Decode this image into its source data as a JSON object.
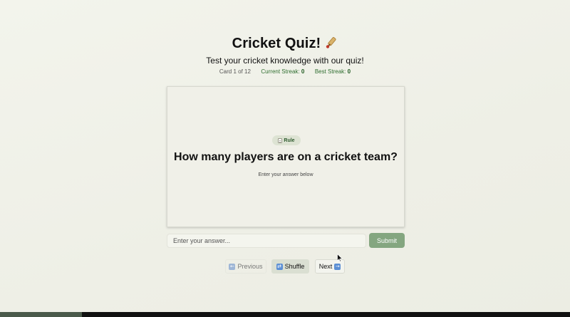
{
  "header": {
    "title": "Cricket Quiz!",
    "title_icon": "cricket-bat-icon",
    "subtitle": "Test your cricket knowledge with our quiz!"
  },
  "stats": {
    "card_progress": "Card 1 of 12",
    "current_streak_label": "Current Streak:",
    "current_streak_value": "0",
    "best_streak_label": "Best Streak:",
    "best_streak_value": "0"
  },
  "card": {
    "badge_label": "Rule",
    "badge_icon": "rule-icon",
    "question": "How many players are on a cricket team?",
    "hint": "Enter your answer below"
  },
  "answer": {
    "placeholder": "Enter your answer...",
    "value": "",
    "submit_label": "Submit"
  },
  "navigation": {
    "previous_label": "Previous",
    "shuffle_label": "Shuffle",
    "next_label": "Next",
    "previous_icon": "left-arrow-icon",
    "shuffle_icon": "shuffle-icon",
    "next_icon": "right-arrow-icon"
  },
  "colors": {
    "accent": "#84a680",
    "streak_green": "#2f6e2f",
    "background": "#f3f4ec"
  }
}
